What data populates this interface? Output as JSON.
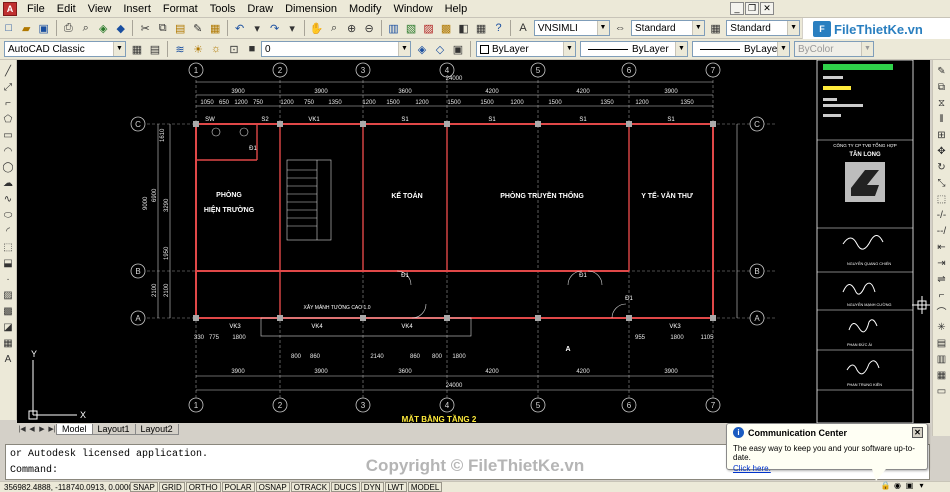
{
  "menu": {
    "items": [
      "File",
      "Edit",
      "View",
      "Insert",
      "Format",
      "Tools",
      "Draw",
      "Dimension",
      "Modify",
      "Window",
      "Help"
    ]
  },
  "styles_toolbar": {
    "text_style": "VNSIMLI",
    "dim_style": "Standard",
    "table_style": "Standard"
  },
  "workspace": {
    "name": "AutoCAD Classic"
  },
  "layers": {
    "current_layer": "0"
  },
  "properties": {
    "color": "ByLayer",
    "linetype": "ByLayer",
    "lineweight": "ByLayer",
    "plotstyle": "ByColor"
  },
  "logo": {
    "text": "FileThietKe.vn"
  },
  "drawing": {
    "grid_labels_top": [
      "1",
      "2",
      "3",
      "4",
      "5",
      "6",
      "7"
    ],
    "grid_labels_side": [
      "C",
      "B",
      "A"
    ],
    "overall_dim": "24000",
    "top_dims": [
      "3900",
      "3900",
      "3600",
      "4200",
      "4200",
      "3900"
    ],
    "top_sub_dims": [
      "1050",
      "650",
      "1200",
      "750",
      "1200",
      "750",
      "1350",
      "1200",
      "1500",
      "1200",
      "1500",
      "1500",
      "1200",
      "1500",
      "1350",
      "1200",
      "1350"
    ],
    "rooms": [
      "PHÒNG",
      "HIỆN TRƯỜNG",
      "KẾ TOÁN",
      "PHÒNG TRUYỀN THỐNG",
      "Y TẾ- VĂN THƯ"
    ],
    "tags": [
      "SW",
      "S2",
      "VK1",
      "S1",
      "S1",
      "S1",
      "S1",
      "Đ1",
      "Đ1",
      "Đ1",
      "Đ1",
      "VK3",
      "VK4",
      "VK4",
      "VK3"
    ],
    "left_dims": [
      "1610",
      "6900",
      "3290",
      "1950",
      "9000",
      "2100",
      "2100"
    ],
    "bottom_dims_1": [
      "330",
      "775",
      "1800",
      "800",
      "860",
      "2140",
      "860",
      "800",
      "1800",
      "955",
      "1800",
      "1105"
    ],
    "bottom_dims_2": [
      "3900",
      "3900",
      "3600",
      "4200",
      "4200",
      "3900"
    ],
    "note": "XÂY MẢNH TƯỜNG CAO 1.0",
    "section_mark": "A",
    "plan_title": "MẶT BẰNG TẦNG 2"
  },
  "title_block": {
    "company": "CÔNG TY CP TVĐ TỔNG HỢP",
    "company_name": "TÂN LONG",
    "signers": [
      "NGUYỄN QUANG CHIẾN",
      "NGUYỄN MẠNH CƯỜNG",
      "PHAN ĐỨC ÁI",
      "PHAN TRUNG KIÊN"
    ]
  },
  "tabs": [
    "Model",
    "Layout1",
    "Layout2"
  ],
  "command": {
    "history": "or Autodesk licensed application.",
    "prompt": "Command:"
  },
  "status": {
    "coords": "356982.4888, -118740.0913, 0.0000",
    "buttons": [
      "SNAP",
      "GRID",
      "ORTHO",
      "POLAR",
      "OSNAP",
      "OTRACK",
      "DUCS",
      "DYN",
      "LWT",
      "MODEL"
    ]
  },
  "balloon": {
    "title": "Communication Center",
    "body": "The easy way to keep you and your software up-to-date.",
    "link": "Click here."
  },
  "watermark": "Copyright © FileThietKe.vn"
}
